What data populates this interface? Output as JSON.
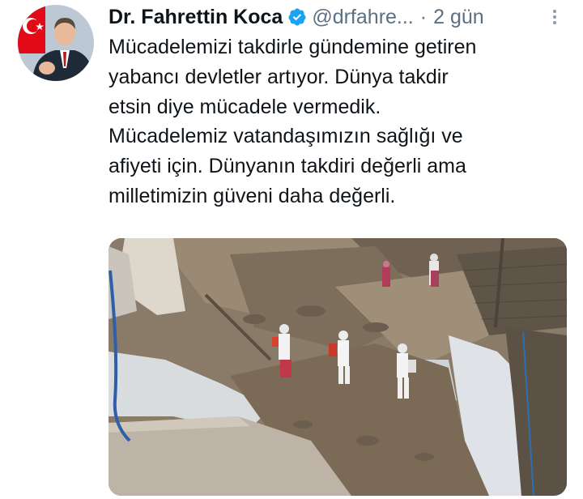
{
  "tweet": {
    "author": {
      "name": "Dr. Fahrettin Koca",
      "handle": "@drfahre...",
      "verified": true
    },
    "separator": "·",
    "time": "2 gün",
    "text_lines": [
      "Mücadelemizi takdirle gündemine getiren",
      "yabancı devletler artıyor. Dünya takdir",
      "etsin diye mücadele vermedik.",
      "Mücadelemiz vatandaşımızın sağlığı ve",
      "afiyeti için. Dünyanın takdiri değerli ama",
      "milletimizin güveni daha değerli."
    ],
    "icons": {
      "verified": "verified-badge-icon",
      "more": "more-vertical-icon"
    },
    "colors": {
      "text": "#0f1419",
      "secondary": "#5b7083",
      "verified": "#1da1f2",
      "avatar_flag_red": "#e30a17"
    }
  }
}
